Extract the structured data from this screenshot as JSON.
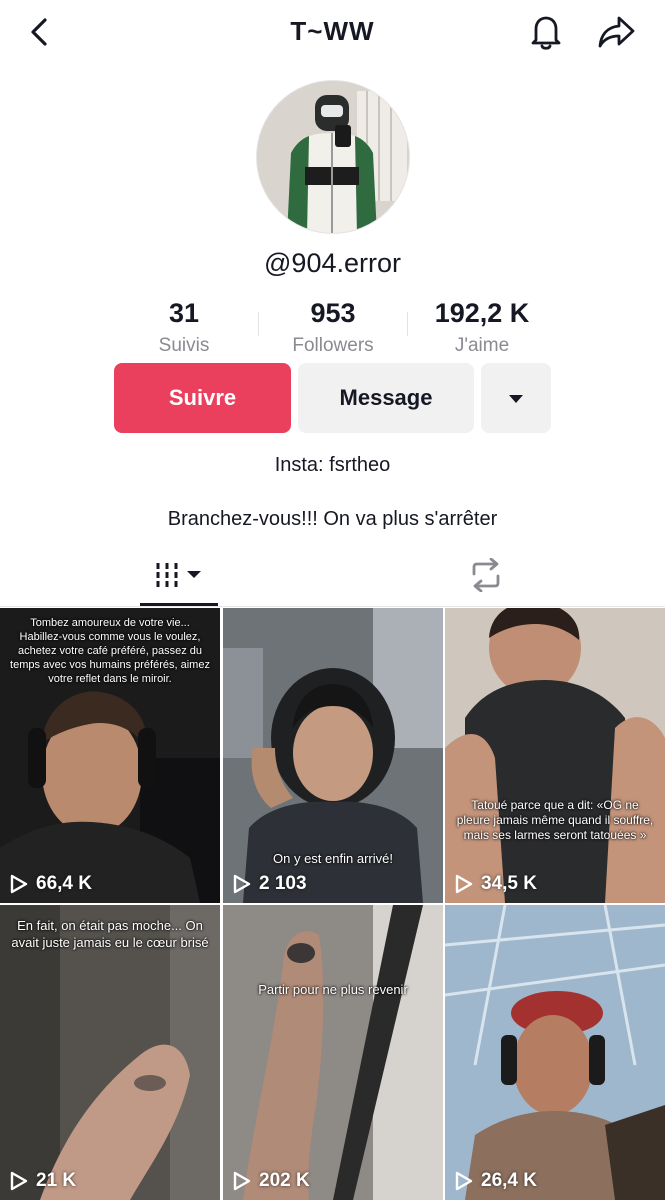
{
  "header": {
    "title": "T~WW",
    "back_icon": "chevron-left-icon",
    "bell_icon": "bell-icon",
    "share_icon": "share-arrow-icon"
  },
  "profile": {
    "username": "@904.error",
    "stats": [
      {
        "value": "31",
        "label": "Suivis"
      },
      {
        "value": "953",
        "label": "Followers"
      },
      {
        "value": "192,2 K",
        "label": "J'aime"
      }
    ],
    "follow_label": "Suivre",
    "message_label": "Message",
    "more_icon": "caret-down-icon",
    "bio_line1": "Insta: fsrtheo",
    "bio_line2": "Branchez-vous!!! On va plus s'arrêter"
  },
  "tabs": {
    "videos_icon": "grid-lines-icon",
    "reposts_icon": "repost-icon"
  },
  "videos": [
    {
      "views": "66,4 K",
      "caption": "Tombez amoureux de votre vie... Habillez-vous comme vous le voulez, achetez votre café préféré, passez du temps avec vos humains préférés, aimez votre reflet dans le miroir."
    },
    {
      "views": "2 103",
      "caption": "On y est enfin arrivé!"
    },
    {
      "views": "34,5 K",
      "caption": "Tatoué parce que a dit: «OG ne pleure jamais même quand il souffre, mais ses larmes seront tatouées »"
    },
    {
      "views": "21 K",
      "caption": "En fait, on était pas moche... On avait juste jamais eu le cœur brisé"
    },
    {
      "views": "202 K",
      "caption": "Partir pour ne plus revenir"
    },
    {
      "views": "26,4 K",
      "caption": ""
    }
  ],
  "colors": {
    "accent": "#ea405d",
    "secondary_button": "#f1f1f2",
    "text": "#161823",
    "muted": "#8a8b91"
  }
}
